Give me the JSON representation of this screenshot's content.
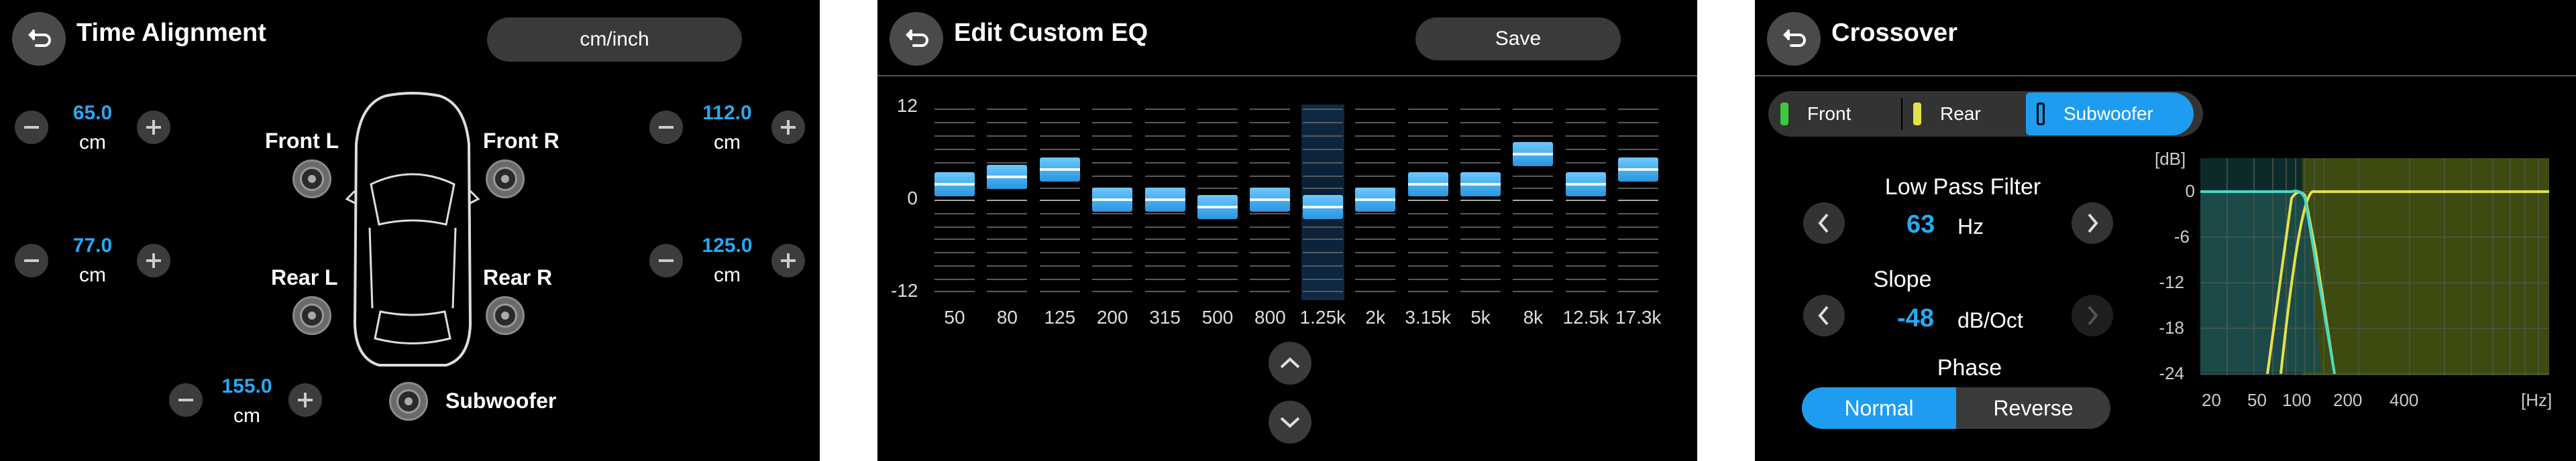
{
  "time_alignment": {
    "title": "Time Alignment",
    "unit_toggle": "cm/inch",
    "front_left": {
      "label": "Front L",
      "value": "65.0",
      "unit": "cm"
    },
    "front_right": {
      "label": "Front R",
      "value": "112.0",
      "unit": "cm"
    },
    "rear_left": {
      "label": "Rear L",
      "value": "77.0",
      "unit": "cm"
    },
    "rear_right": {
      "label": "Rear R",
      "value": "125.0",
      "unit": "cm"
    },
    "subwoofer": {
      "label": "Subwoofer",
      "value": "155.0",
      "unit": "cm"
    },
    "icons": {
      "back": "back-arrow-icon",
      "minus": "minus-icon",
      "plus": "plus-icon",
      "speaker": "speaker-icon",
      "car": "car-top-view-icon"
    }
  },
  "custom_eq": {
    "title": "Edit Custom EQ",
    "save_label": "Save",
    "y_ticks": [
      "12",
      "0",
      "-12"
    ],
    "bands": [
      {
        "freq": "50",
        "gain": 2
      },
      {
        "freq": "80",
        "gain": 3
      },
      {
        "freq": "125",
        "gain": 4
      },
      {
        "freq": "200",
        "gain": 0
      },
      {
        "freq": "315",
        "gain": 0
      },
      {
        "freq": "500",
        "gain": -1
      },
      {
        "freq": "800",
        "gain": 0
      },
      {
        "freq": "1.25k",
        "gain": -1
      },
      {
        "freq": "2k",
        "gain": 0
      },
      {
        "freq": "3.15k",
        "gain": 2
      },
      {
        "freq": "5k",
        "gain": 2
      },
      {
        "freq": "8k",
        "gain": 6
      },
      {
        "freq": "12.5k",
        "gain": 2
      },
      {
        "freq": "17.3k",
        "gain": 4
      }
    ],
    "selected_band": "1.25k",
    "icons": {
      "scroll_up": "chevron-up-icon",
      "scroll_down": "chevron-down-icon"
    }
  },
  "crossover": {
    "title": "Crossover",
    "tabs": [
      {
        "label": "Front",
        "color": "#3ec83e",
        "active": false
      },
      {
        "label": "Rear",
        "color": "#e6e04a",
        "active": false
      },
      {
        "label": "Subwoofer",
        "color": "#1e9cf0",
        "active": true
      }
    ],
    "low_pass_label": "Low Pass Filter",
    "low_pass_value": "63",
    "low_pass_unit": "Hz",
    "slope_label": "Slope",
    "slope_value": "-48",
    "slope_unit": "dB/Oct",
    "phase_label": "Phase",
    "phase_normal": "Normal",
    "phase_reverse": "Reverse",
    "graph_y_unit": "[dB]",
    "graph_x_unit": "[Hz]",
    "graph_y_ticks": [
      "0",
      "-6",
      "-12",
      "-18",
      "-24"
    ],
    "graph_x_ticks": [
      "20",
      "50",
      "100",
      "200",
      "400"
    ],
    "colors": {
      "accent": "#2aa8f2",
      "sub": "#44d9c6",
      "rear": "#e6e04a"
    }
  }
}
